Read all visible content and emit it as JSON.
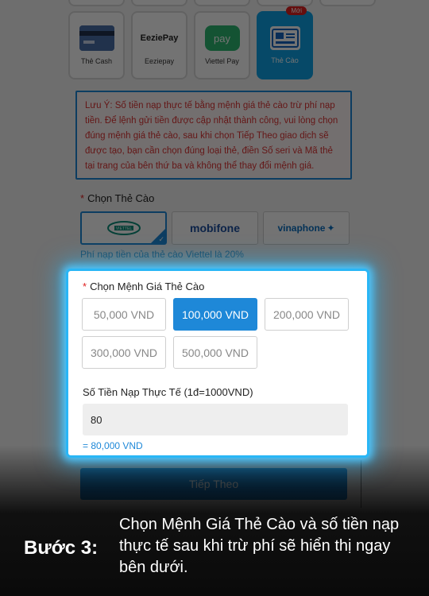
{
  "payment_methods": [
    {
      "label": "Thẻ Cash",
      "icon": "credit-card-icon"
    },
    {
      "label": "Eeziepay",
      "icon": "eeziepay-logo",
      "logo_text": "EeziePay"
    },
    {
      "label": "Viettel Pay",
      "icon": "viettelpay-logo",
      "logo_text": "pay"
    },
    {
      "label": "Thẻ Cào",
      "icon": "scratch-card-icon",
      "badge": "Mới",
      "active": true
    }
  ],
  "notice": "Lưu Ý: Số tiền nạp thực tế bằng mệnh giá thẻ cào trừ phí nạp tiền. Để lệnh gửi tiền được cập nhật thành công, vui lòng chọn đúng mệnh giá thẻ cào, sau khi chọn Tiếp Theo giao dịch sẽ được tạo, bạn cần chọn đúng loại thẻ, điền Số seri và Mã thẻ tại trang của bên thứ ba và không thể thay đổi mệnh giá.",
  "card_select": {
    "required_mark": "*",
    "label": "Chọn Thẻ Cào",
    "telcos": [
      {
        "name": "VIETTEL",
        "selected": true
      },
      {
        "name": "mobifone",
        "selected": false
      },
      {
        "name": "vinaphone",
        "selected": false
      }
    ],
    "fee_note": "Phí nạp tiền của thẻ cào Viettel là 20%"
  },
  "denomination": {
    "required_mark": "*",
    "label": "Chọn Mệnh Giá Thẻ Cào",
    "options": [
      "50,000 VND",
      "100,000 VND",
      "200,000 VND",
      "300,000 VND",
      "500,000 VND"
    ],
    "selected": "100,000 VND"
  },
  "real_amount": {
    "label": "Số Tiền Nạp Thực Tế (1đ=1000VND)",
    "value": "80",
    "equivalent": "= 80,000 VND"
  },
  "next_button": "Tiếp Theo",
  "caption": {
    "step": "Bước 3:",
    "text": "Chọn Mệnh Giá Thẻ Cào và số tiền nạp thực tế sau khi trừ phí sẽ hiển thị ngay bên dưới."
  },
  "colors": {
    "accent": "#1e88d8",
    "active_tile": "#0fa3e6",
    "glow": "#29b6f6",
    "notice_text": "#dd3333",
    "badge": "#e02020"
  }
}
